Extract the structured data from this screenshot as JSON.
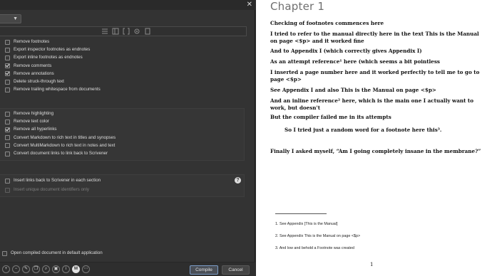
{
  "window": {
    "close_label": "✕"
  },
  "options_group1": [
    {
      "label": "Remove footnotes",
      "checked": false
    },
    {
      "label": "Export inspector footnotes as endnotes",
      "checked": false
    },
    {
      "label": "Export inline footnotes as endnotes",
      "checked": false
    },
    {
      "label": "Remove comments",
      "checked": true
    },
    {
      "label": "Remove annotations",
      "checked": true
    },
    {
      "label": "Delete struck-through text",
      "checked": false
    },
    {
      "label": "Remove trailing whitespace from documents",
      "checked": false
    }
  ],
  "options_group2": [
    {
      "label": "Remove highlighting",
      "checked": false
    },
    {
      "label": "Remove text color",
      "checked": false
    },
    {
      "label": "Remove all hyperlinks",
      "checked": true
    },
    {
      "label": "Convert Markdown to rich text in titles and synopses",
      "checked": false
    },
    {
      "label": "Convert MultiMarkdown to rich text in notes and text",
      "checked": false
    },
    {
      "label": "Convert document links to link back to Scrivener",
      "checked": false
    }
  ],
  "options_group3": [
    {
      "label": "Insert links back to Scrivener in each section",
      "checked": false
    },
    {
      "label": "Insert unique document identifiers only",
      "checked": false,
      "disabled": true
    }
  ],
  "help_label": "?",
  "open_after": {
    "label": "Open compiled document in default application",
    "checked": false
  },
  "buttons": {
    "compile": "Compile",
    "cancel": "Cancel"
  },
  "bottom_icons": [
    "plus-icon",
    "minus-icon",
    "edit-icon",
    "duplicate-icon",
    "search-icon",
    "image-icon",
    "info-icon",
    "manuscript-icon",
    "more-icon"
  ],
  "preview": {
    "chapter_title": "Chapter 1",
    "paragraphs": [
      "Checking of footnotes commences here",
      "I tried to refer to the manual directly here in the text This is the Manual on page <$p> and it worked fine",
      "And to Appendix I (which correctly gives Appendix I)",
      "As an attempt reference¹ here (which seems a bit pointless",
      "I inserted a page number here and it worked perfectly to tell me to go to page <$p>",
      "See Appendix I and also This is the Manual on page <$p>",
      "And an inline reference² here, which is the main one I actually want to work, but doesn't",
      "But the compiler failed me in its attempts",
      "So I tried just a random word for a footnote here this³.",
      "Finally I asked myself, “Am I going completely insane in the membrane?”"
    ],
    "footnotes": [
      "1. See Appendix [This is the Manual]",
      "2. See Appendix This is the Manual on page <$p>",
      "3. And low and behold a Footnote was created"
    ],
    "page_number": "1"
  }
}
